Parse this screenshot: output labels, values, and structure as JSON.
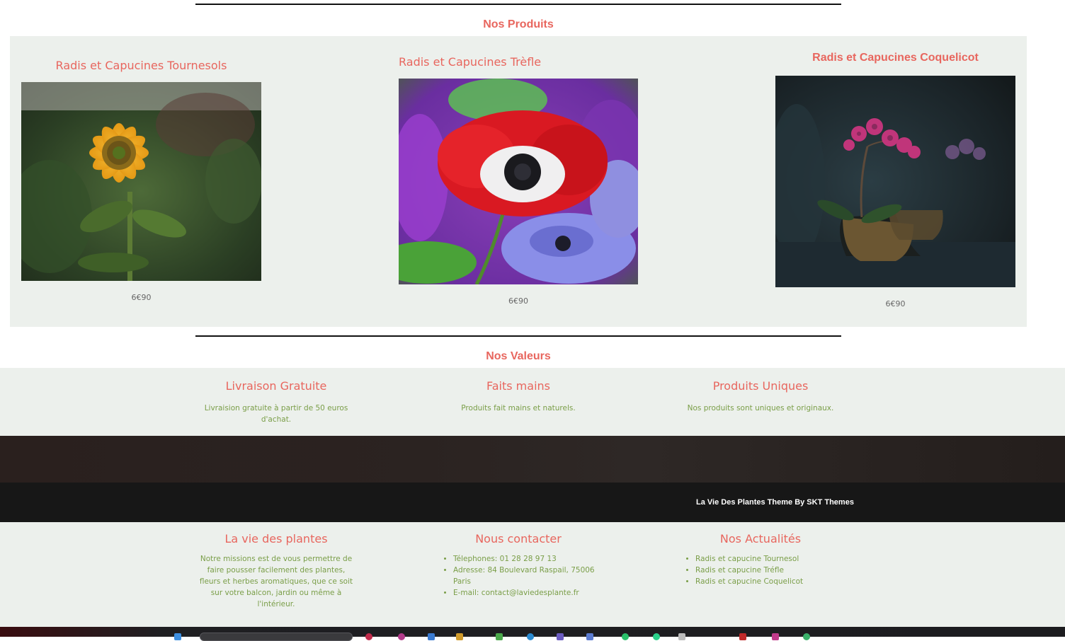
{
  "products_section": {
    "title": "Nos Produits",
    "items": [
      {
        "title": "Radis et Capucines Tournesols",
        "price": "6€90",
        "image": "sunflower-photo"
      },
      {
        "title": "Radis et Capucines Trèfle",
        "price": "6€90",
        "image": "poppy-anemone-photo"
      },
      {
        "title": "Radis et Capucines Coquelicot",
        "price": "6€90",
        "image": "orchid-photo"
      }
    ]
  },
  "values_section": {
    "title": "Nos Valeurs",
    "items": [
      {
        "title": "Livraison Gratuite",
        "text": "Livraision gratuite à partir de 50 euros d'achat."
      },
      {
        "title": "Faits mains",
        "text": "Produits fait mains et naturels."
      },
      {
        "title": "Produits Uniques",
        "text": "Nos produits sont uniques et originaux."
      }
    ]
  },
  "credit": {
    "text": "La Vie Des Plantes Theme By SKT Themes"
  },
  "footer": {
    "about": {
      "title": "La vie des plantes",
      "text": "Notre missions est de vous permettre de faire pousser facilement des plantes, fleurs et herbes aromatiques, que ce soit sur votre balcon, jardin ou même à l'intérieur."
    },
    "contact": {
      "title": "Nous contacter",
      "items": [
        "Télephones: 01 28 28 97 13",
        "Adresse: 84 Boulevard Raspail, 75006 Paris",
        "E-mail: contact@laviedesplante.fr"
      ]
    },
    "news": {
      "title": "Nos Actualités",
      "items": [
        "Radis et capucine Tournesol",
        "Radis et capucine Tréfle",
        "Radis et capucine Coquelicot"
      ]
    }
  },
  "colors": {
    "accent": "#e8665e",
    "text_green": "#7a9e48",
    "panel_bg": "#ecf0ec",
    "footer_dark": "#171717"
  }
}
